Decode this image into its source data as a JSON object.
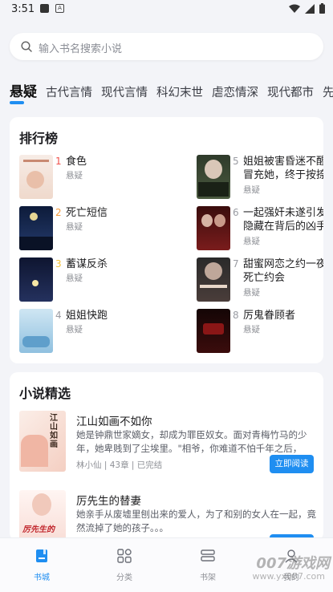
{
  "status_bar": {
    "time": "3:51",
    "notif_a": "A"
  },
  "search": {
    "placeholder": "输入书名搜索小说"
  },
  "tabs": [
    {
      "label": "悬疑",
      "active": true
    },
    {
      "label": "古代言情"
    },
    {
      "label": "现代言情"
    },
    {
      "label": "科幻末世"
    },
    {
      "label": "虐恋情深"
    },
    {
      "label": "现代都市"
    },
    {
      "label": "先"
    }
  ],
  "ranking": {
    "title": "排行榜",
    "items": [
      {
        "num": "1",
        "title": "食色",
        "tag": "悬疑"
      },
      {
        "num": "2",
        "title": "死亡短信",
        "tag": "悬疑"
      },
      {
        "num": "3",
        "title": "蓄谋反杀",
        "tag": "悬疑"
      },
      {
        "num": "4",
        "title": "姐姐快跑",
        "tag": "悬疑"
      },
      {
        "num": "5",
        "title": "姐姐被害昏迷不醒，妹妹",
        "title2": "冒充她，终于按捺不住",
        "tag": "悬疑"
      },
      {
        "num": "6",
        "title": "一起强奸未遂引发的，",
        "title2": "隐藏在背后的凶手",
        "tag": "悬疑"
      },
      {
        "num": "7",
        "title": "甜蜜网恋之约一夜，",
        "title2": "死亡约会",
        "tag": "悬疑"
      },
      {
        "num": "8",
        "title": "厉鬼眷顾者",
        "tag": "悬疑"
      }
    ],
    "num_colors": [
      "#f0514b",
      "#f59b3c",
      "#f3c23a",
      "#9a9ca3"
    ]
  },
  "featured": {
    "title": "小说精选",
    "items": [
      {
        "title": "江山如画不如你",
        "desc": "她是钟鼎世家嫡女，却成为罪臣奴女。面对青梅竹马的少年，她卑贱到了尘埃里。\"相爷，你难道不怕千年之后，背...",
        "meta": "林小仙 | 43章 | 已完结",
        "button": "立即阅读",
        "cover_text": "江山如画"
      },
      {
        "title": "厉先生的替妻",
        "desc": "她亲手从废墟里刨出来的爱人，为了和别的女人在一起，竟然流掉了她的孩子。。。",
        "meta": "",
        "button": "立即阅读",
        "cover_text": "厉先生的"
      }
    ]
  },
  "bottom_nav": [
    {
      "label": "书城",
      "icon": "book-city-icon",
      "active": true
    },
    {
      "label": "分类",
      "icon": "grid-icon"
    },
    {
      "label": "书架",
      "icon": "bookshelf-icon"
    },
    {
      "label": "我的",
      "icon": "profile-icon"
    }
  ],
  "watermark": {
    "main": "007游戏网",
    "sub": "www.yx007.com"
  },
  "colors": {
    "accent": "#1f8ef1",
    "background": "#f3f4f8"
  }
}
